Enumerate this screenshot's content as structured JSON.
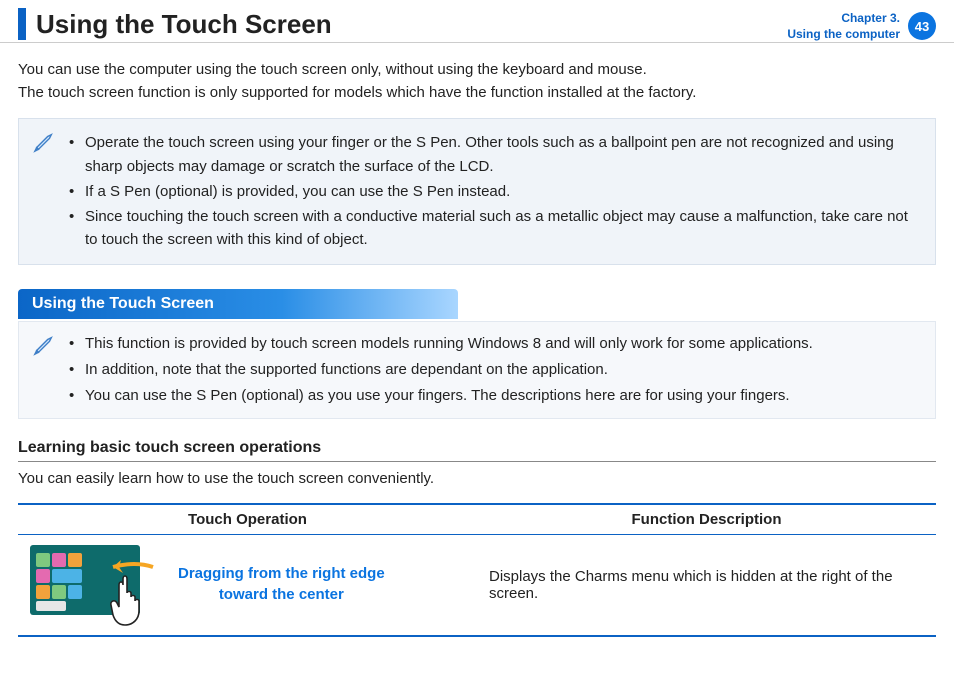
{
  "header": {
    "title": "Using the Touch Screen",
    "chapter_line1": "Chapter 3.",
    "chapter_line2": "Using the computer",
    "page_number": "43"
  },
  "intro_line1": "You can use the computer using the touch screen only, without using the keyboard and mouse.",
  "intro_line2": "The touch screen function is only supported for models which have the function installed at the factory.",
  "notes1": [
    "Operate the touch screen using your finger or the S Pen. Other tools such as a ballpoint pen are not recognized and using sharp objects may damage or scratch the surface of the LCD.",
    "If a S Pen (optional) is provided, you can use the S Pen instead.",
    "Since touching the touch screen with a conductive material such as a metallic object may cause a malfunction, take care not to touch the screen with this kind of object."
  ],
  "section_heading": "Using the Touch Screen",
  "notes2": [
    "This function is provided by touch screen models running Windows 8 and will only work for some applications.",
    "In addition, note that the supported functions are dependant on the application.",
    "You can use the S Pen (optional) as you use your fingers. The descriptions here are for using your fingers."
  ],
  "sub_heading": "Learning basic touch screen operations",
  "sub_intro": "You can easily learn how to use the touch screen conveniently.",
  "table": {
    "col1": "Touch Operation",
    "col2": "Function Description",
    "row1": {
      "caption_line1": "Dragging from the right edge",
      "caption_line2": "toward the center",
      "description": "Displays the Charms menu which is hidden at the right of the screen."
    }
  }
}
